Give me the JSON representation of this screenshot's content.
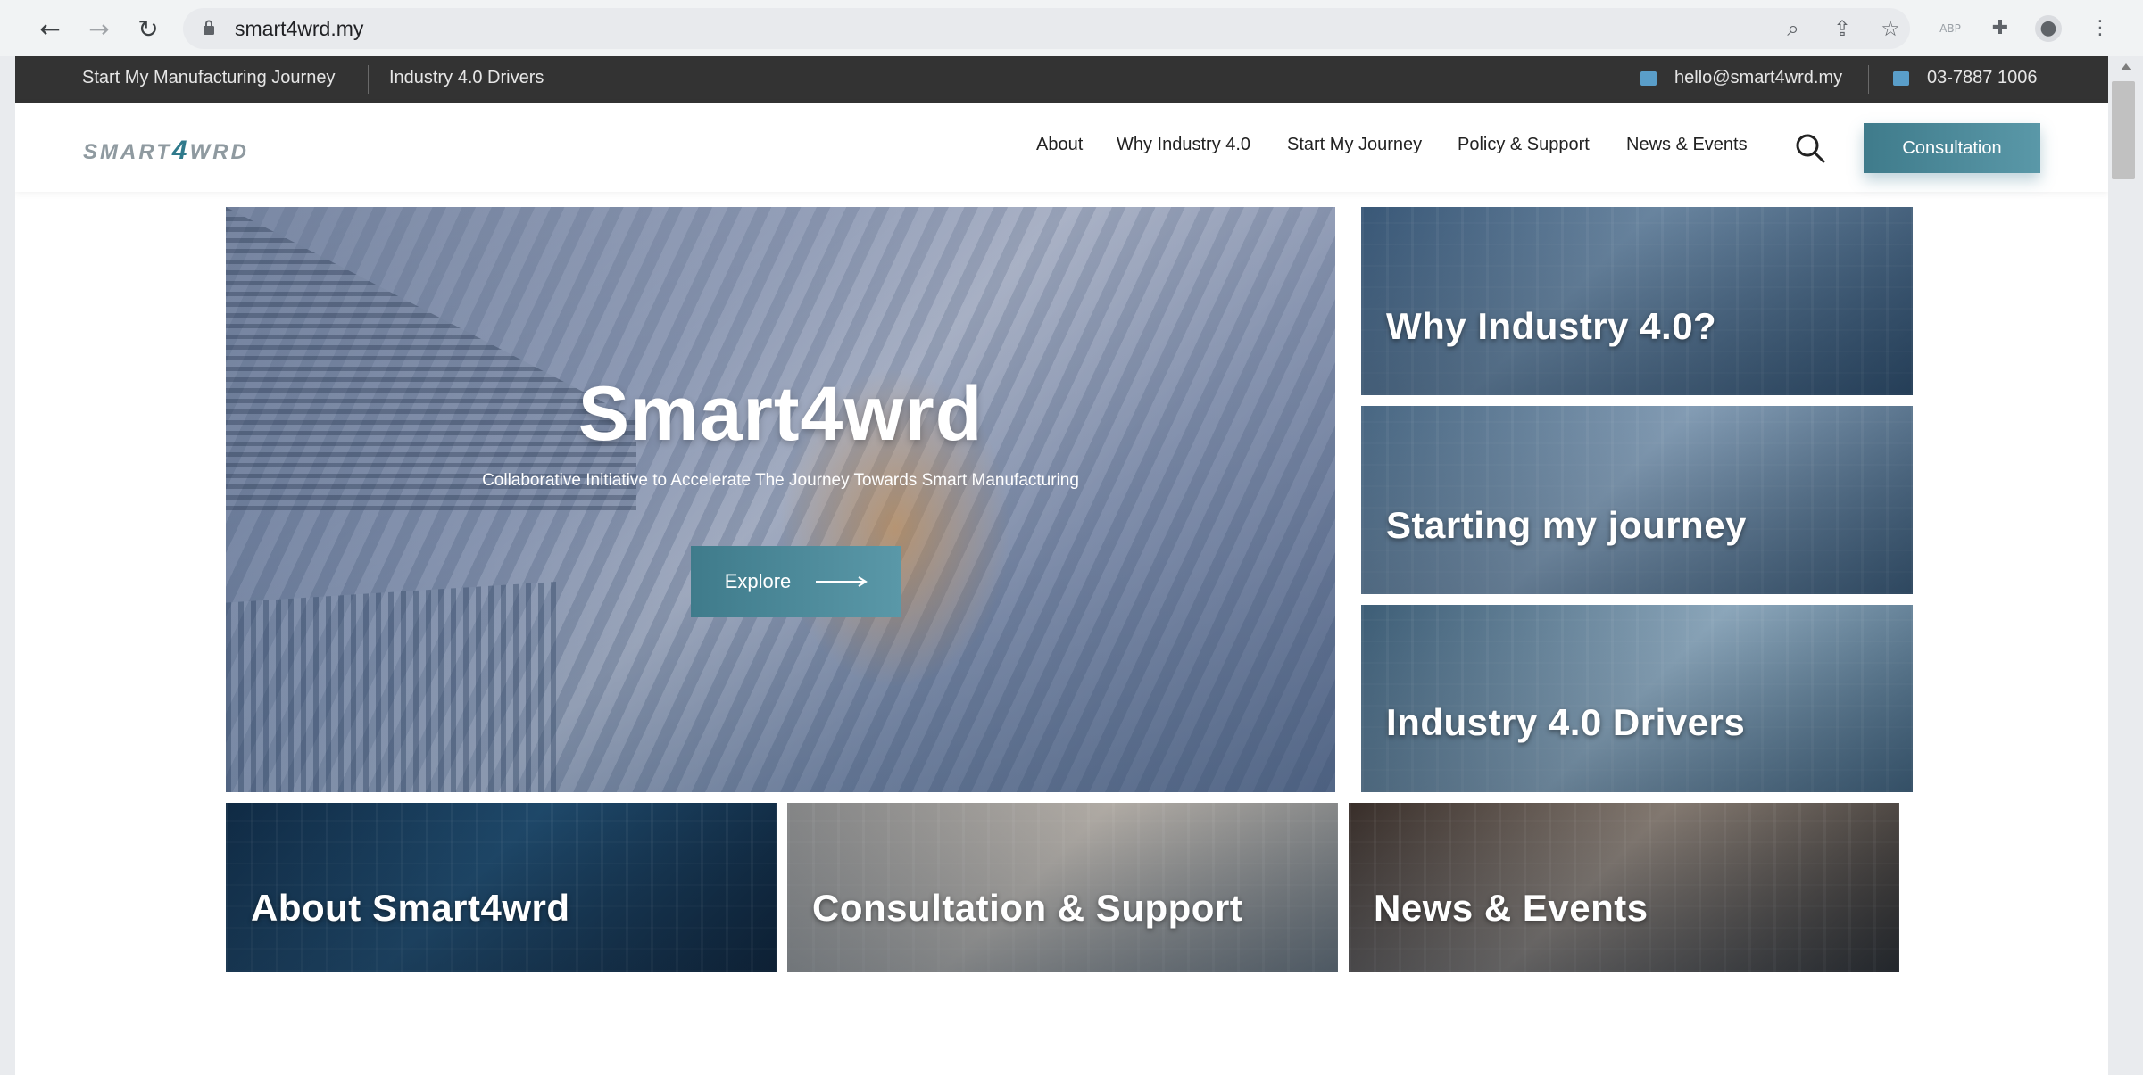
{
  "browser": {
    "url": "smart4wrd.my",
    "back_icon": "arrow-left-icon",
    "forward_icon": "arrow-right-icon",
    "reload_icon": "reload-icon"
  },
  "topbar": {
    "links": [
      "Start My Manufacturing Journey",
      "Industry 4.0 Drivers"
    ],
    "email": "hello@smart4wrd.my",
    "phone": "03-7887 1006"
  },
  "header": {
    "logo_text_a": "SMART",
    "logo_text_num": "4",
    "logo_text_b": "WRD",
    "nav": [
      "About",
      "Why Industry 4.0",
      "Start My Journey",
      "Policy & Support",
      "News & Events"
    ],
    "cta": "Consultation"
  },
  "hero": {
    "title": "Smart4wrd",
    "subtitle": "Collaborative Initiative to Accelerate The Journey Towards Smart Manufacturing",
    "button": "Explore"
  },
  "tiles": {
    "why": "Why Industry 4.0?",
    "start": "Starting my journey",
    "drivers": "Industry 4.0 Drivers",
    "about": "About Smart4wrd",
    "consult": "Consultation & Support",
    "news": "News & Events"
  },
  "colors": {
    "accent": "#4a8a9b",
    "topbar_bg": "#333333"
  }
}
